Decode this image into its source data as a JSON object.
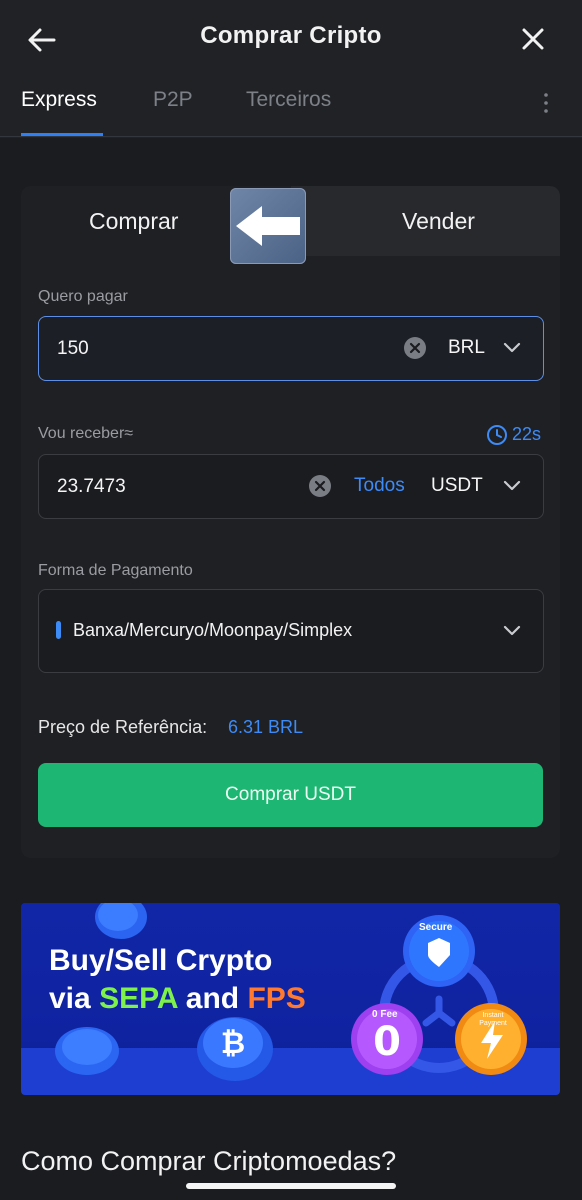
{
  "header": {
    "title": "Comprar Cripto",
    "tabs": [
      {
        "label": "Express",
        "active": true
      },
      {
        "label": "P2P",
        "active": false
      },
      {
        "label": "Terceiros",
        "active": false
      }
    ]
  },
  "trade": {
    "buy_label": "Comprar",
    "sell_label": "Vender",
    "pay": {
      "label": "Quero pagar",
      "value": "150",
      "currency": "BRL"
    },
    "receive": {
      "label": "Vou receber≈",
      "timer": "22s",
      "value": "23.7473",
      "all_label": "Todos",
      "currency": "USDT"
    },
    "payment": {
      "label": "Forma de Pagamento",
      "value": "Banxa/Mercuryo/Moonpay/Simplex"
    },
    "reference": {
      "label": "Preço de Referência:",
      "value": "6.31 BRL"
    },
    "submit_label": "Comprar USDT"
  },
  "banner": {
    "line1": "Buy/Sell Crypto",
    "line2_prefix": "via",
    "line2_green": "SEPA",
    "line2_mid": "and",
    "line2_orange": "FPS",
    "badge_secure": "Secure",
    "badge_fee_label": "0 Fee",
    "badge_fee_value": "0",
    "badge_instant": "Instant Payment"
  },
  "section_title": "Como Comprar Criptomoedas?",
  "colors": {
    "accent": "#3d8bf7",
    "buy_button": "#1eb673",
    "background": "#1a1c20"
  }
}
